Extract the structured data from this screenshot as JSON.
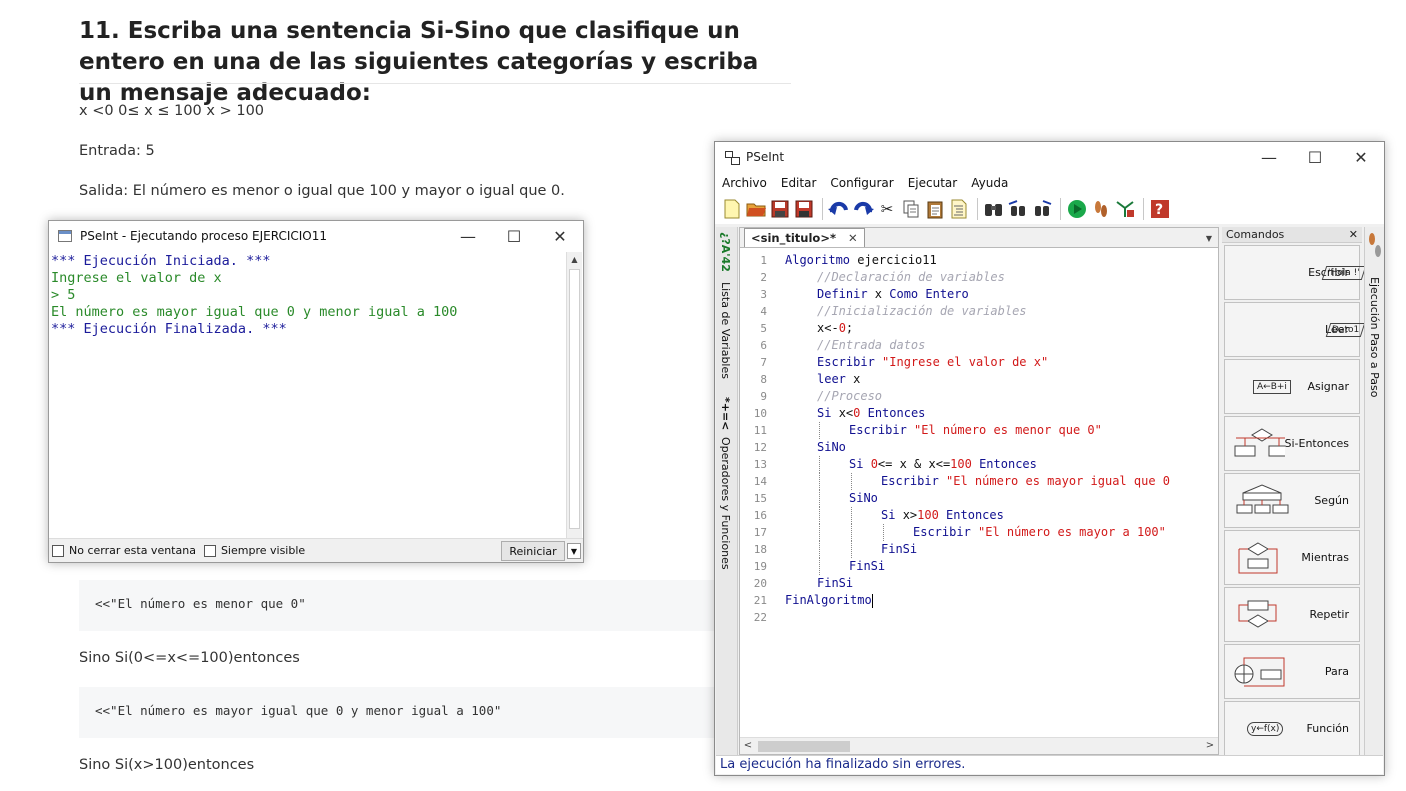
{
  "article": {
    "title": "11. Escriba una sentencia Si-Sino que clasifique un entero en una de las siguientes categorías y escriba un mensaje adecuado:",
    "conditions": "x <0 0≤ x ≤ 100 x > 100",
    "input_example": "Entrada: 5",
    "output_example": "Salida: El número es menor o igual que 100 y mayor o igual que 0.",
    "code_snippet_1": "<<\"El número es menor que 0\"",
    "text_1": "Sino Si(0<=x<=100)entonces",
    "code_snippet_2": "<<\"El número es mayor igual que 0 y menor igual a 100\"",
    "text_2": "Sino Si(x>100)entonces"
  },
  "run_window": {
    "title": "PSeInt - Ejecutando proceso EJERCICIO11",
    "console_lines": [
      {
        "text": "*** Ejecución Iniciada. ***",
        "color": "blue"
      },
      {
        "text": "Ingrese el valor de x",
        "color": "green"
      },
      {
        "text": "> 5",
        "color": "green"
      },
      {
        "text": "El número es mayor igual que 0 y menor igual a 100",
        "color": "green"
      },
      {
        "text": "*** Ejecución Finalizada. ***",
        "color": "blue"
      }
    ],
    "checkbox_keep_open": "No cerrar esta ventana",
    "checkbox_always_visible": "Siempre visible",
    "restart_button": "Reiniciar"
  },
  "pseint": {
    "title": "PSeInt",
    "menu": [
      "Archivo",
      "Editar",
      "Configurar",
      "Ejecutar",
      "Ayuda"
    ],
    "toolbar_icons": [
      "new-file-icon",
      "open-folder-icon",
      "save-icon",
      "save-as-icon",
      "undo-icon",
      "redo-icon",
      "cut-icon",
      "copy-icon",
      "paste-icon",
      "indent-icon",
      "find-icon",
      "find-previous-icon",
      "find-next-icon",
      "run-icon",
      "step-by-step-icon",
      "debug-icon",
      "help-icon"
    ],
    "left_tabs": {
      "variables": "Lista de Variables",
      "operators": "Operadores y Funciones",
      "variables_symbol": "¿?A'42",
      "operators_symbol": "*+=<"
    },
    "editor_tab": "<sin_titulo>*",
    "code_lines": [
      [
        [
          "kw",
          "Algoritmo "
        ],
        [
          "id",
          "ejercicio11"
        ]
      ],
      [
        [
          "cm",
          "//Declaración de variables"
        ]
      ],
      [
        [
          "kw",
          "Definir "
        ],
        [
          "id",
          "x "
        ],
        [
          "kw",
          "Como Entero"
        ]
      ],
      [
        [
          "cm",
          "//Inicialización de variables"
        ]
      ],
      [
        [
          "id",
          "x<-"
        ],
        [
          "nu",
          "0"
        ],
        [
          "id",
          ";"
        ]
      ],
      [
        [
          "cm",
          "//Entrada datos"
        ]
      ],
      [
        [
          "kw",
          "Escribir "
        ],
        [
          "st",
          "\"Ingrese el valor de x\""
        ]
      ],
      [
        [
          "kw",
          "leer "
        ],
        [
          "id",
          "x"
        ]
      ],
      [
        [
          "cm",
          "//Proceso"
        ]
      ],
      [
        [
          "kw",
          "Si "
        ],
        [
          "id",
          "x<"
        ],
        [
          "nu",
          "0"
        ],
        [
          "kw",
          " Entonces"
        ]
      ],
      [
        [
          "kw",
          "Escribir "
        ],
        [
          "st",
          "\"El número es menor que 0\""
        ]
      ],
      [
        [
          "kw",
          "SiNo"
        ]
      ],
      [
        [
          "kw",
          "Si "
        ],
        [
          "nu",
          "0"
        ],
        [
          "id",
          "<= x & x<="
        ],
        [
          "nu",
          "100"
        ],
        [
          "kw",
          " Entonces"
        ]
      ],
      [
        [
          "kw",
          "Escribir "
        ],
        [
          "st",
          "\"El número es mayor igual que 0"
        ]
      ],
      [
        [
          "kw",
          "SiNo"
        ]
      ],
      [
        [
          "kw",
          "Si "
        ],
        [
          "id",
          "x>"
        ],
        [
          "nu",
          "100"
        ],
        [
          "kw",
          " Entonces"
        ]
      ],
      [
        [
          "kw",
          "Escribir "
        ],
        [
          "st",
          "\"El número es mayor a 100\""
        ]
      ],
      [
        [
          "kw",
          "FinSi"
        ]
      ],
      [
        [
          "kw",
          "FinSi"
        ]
      ],
      [
        [
          "kw",
          "FinSi"
        ]
      ],
      [
        [
          "kw",
          "FinAlgoritmo"
        ]
      ],
      []
    ],
    "commands_title": "Comandos",
    "commands": [
      {
        "label": "Escribir",
        "shape": "'Hola !'"
      },
      {
        "label": "Leer",
        "shape": "Dato1"
      },
      {
        "label": "Asignar",
        "shape": "A←B+i"
      },
      {
        "label": "Si-Entonces",
        "shape": "A>B"
      },
      {
        "label": "Según",
        "shape": "1 2 3"
      },
      {
        "label": "Mientras",
        "shape": "A>B"
      },
      {
        "label": "Repetir",
        "shape": "A>B"
      },
      {
        "label": "Para",
        "shape": "1↑N"
      },
      {
        "label": "Función",
        "shape": "y←f(x)"
      }
    ],
    "right_tab": "Ejecución Paso a Paso",
    "status": "La ejecución ha finalizado sin errores."
  }
}
